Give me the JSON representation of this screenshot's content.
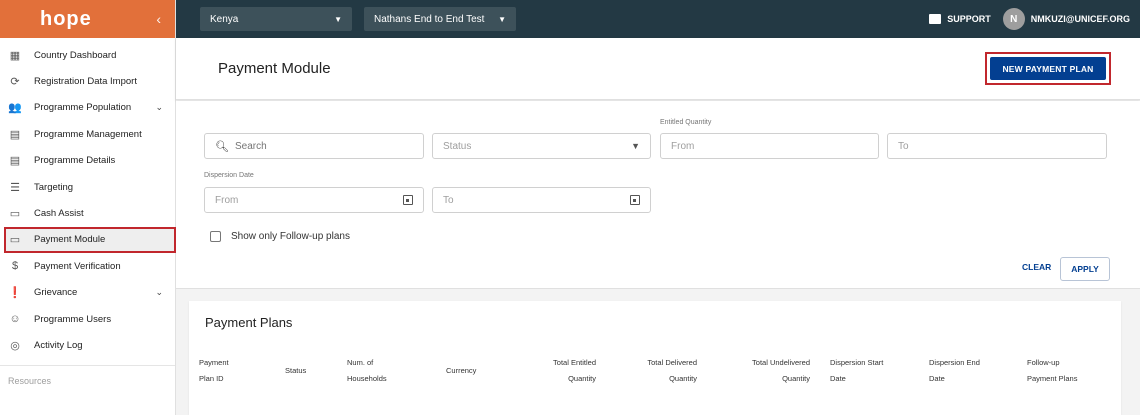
{
  "brand": {
    "logo_text": "hope",
    "collapse_icon": "chevron-left-icon"
  },
  "sidebar": {
    "items": [
      {
        "label": "Country Dashboard",
        "icon": "dashboard-icon"
      },
      {
        "label": "Registration Data Import",
        "icon": "sync-icon"
      },
      {
        "label": "Programme Population",
        "icon": "people-icon",
        "expandable": true
      },
      {
        "label": "Programme Management",
        "icon": "document-icon"
      },
      {
        "label": "Programme Details",
        "icon": "document-icon"
      },
      {
        "label": "Targeting",
        "icon": "list-icon"
      },
      {
        "label": "Cash Assist",
        "icon": "card-icon"
      },
      {
        "label": "Payment Module",
        "icon": "card-icon",
        "active": true
      },
      {
        "label": "Payment Verification",
        "icon": "dollar-icon"
      },
      {
        "label": "Grievance",
        "icon": "alert-icon",
        "expandable": true
      },
      {
        "label": "Programme Users",
        "icon": "group-icon"
      },
      {
        "label": "Activity Log",
        "icon": "history-icon"
      }
    ],
    "resources_label": "Resources"
  },
  "topbar": {
    "country": "Kenya",
    "programme": "Nathans End to End Test",
    "support_label": "SUPPORT",
    "avatar_initial": "N",
    "user_email": "NMKUZI@UNICEF.ORG"
  },
  "header": {
    "title": "Payment Module",
    "new_plan_button": "NEW PAYMENT PLAN"
  },
  "filters": {
    "search_placeholder": "Search",
    "status_placeholder": "Status",
    "entitled_quantity_label": "Entitled Quantity",
    "entitled_from": "From",
    "entitled_to": "To",
    "dispersion_date_label": "Dispersion Date",
    "dispersion_from": "From",
    "dispersion_to": "To",
    "followup_checkbox_label": "Show only Follow-up plans",
    "clear_button": "CLEAR",
    "apply_button": "APPLY"
  },
  "plans": {
    "title": "Payment Plans",
    "columns": [
      [
        "Payment",
        "Plan ID"
      ],
      [
        "Status"
      ],
      [
        "Num. of",
        "Households"
      ],
      [
        "Currency"
      ],
      [
        "Total Entitled",
        "Quantity"
      ],
      [
        "Total Delivered",
        "Quantity"
      ],
      [
        "Total Undelivered",
        "Quantity"
      ],
      [
        "Dispersion Start",
        "Date"
      ],
      [
        "Dispersion End",
        "Date"
      ],
      [
        "Follow-up",
        "Payment Plans"
      ]
    ]
  },
  "colors": {
    "brand_orange": "#e2703a",
    "topbar": "#233944",
    "primary_blue": "#033f91",
    "highlight_red": "#c1272d"
  }
}
